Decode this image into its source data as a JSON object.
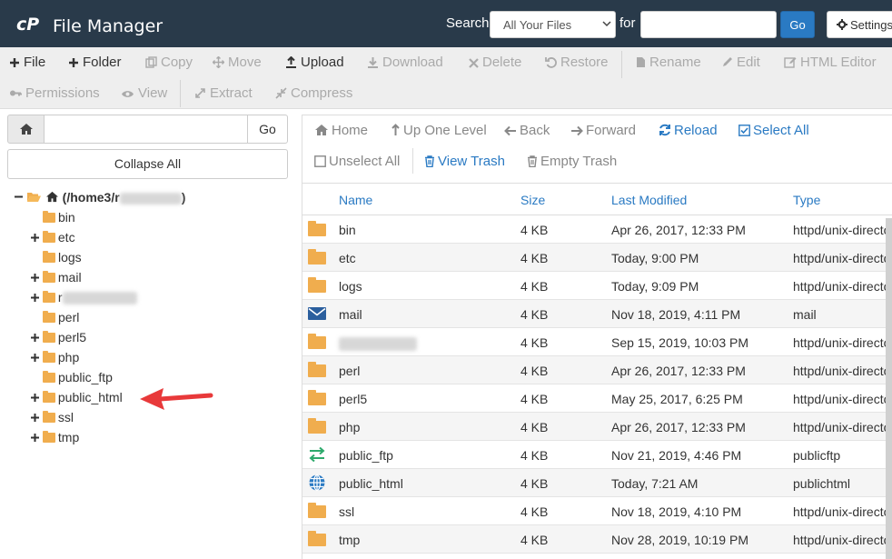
{
  "header": {
    "title": "File Manager",
    "logo_icon": "cpanel-logo",
    "search_label": "Search",
    "search_scope": "All Your Files",
    "for_label": "for",
    "search_value": "",
    "go_label": "Go",
    "settings_label": "Settings"
  },
  "toolbar": {
    "row1": [
      {
        "label": "File",
        "icon": "plus-icon",
        "enabled": true
      },
      {
        "label": "Folder",
        "icon": "plus-icon",
        "enabled": true
      },
      {
        "label": "Copy",
        "icon": "copy-icon",
        "enabled": false
      },
      {
        "label": "Move",
        "icon": "move-icon",
        "enabled": false
      },
      {
        "label": "Upload",
        "icon": "upload-icon",
        "enabled": true
      },
      {
        "label": "Download",
        "icon": "download-icon",
        "enabled": false
      },
      {
        "label": "Delete",
        "icon": "delete-icon",
        "enabled": false
      },
      {
        "label": "Restore",
        "icon": "restore-icon",
        "enabled": false
      },
      {
        "label": "Rename",
        "icon": "file-icon",
        "enabled": false
      },
      {
        "label": "Edit",
        "icon": "pencil-icon",
        "enabled": false
      },
      {
        "label": "HTML Editor",
        "icon": "edit-square-icon",
        "enabled": false
      }
    ],
    "row2": [
      {
        "label": "Permissions",
        "icon": "key-icon",
        "enabled": false
      },
      {
        "label": "View",
        "icon": "eye-icon",
        "enabled": false
      },
      {
        "label": "Extract",
        "icon": "expand-icon",
        "enabled": false
      },
      {
        "label": "Compress",
        "icon": "compress-icon",
        "enabled": false
      }
    ]
  },
  "left": {
    "path_value": "",
    "go_label": "Go",
    "collapse_label": "Collapse All",
    "root_label": "(/home3/r",
    "root_suffix": ")",
    "tree": [
      {
        "label": "bin",
        "expandable": false
      },
      {
        "label": "etc",
        "expandable": true
      },
      {
        "label": "logs",
        "expandable": false
      },
      {
        "label": "mail",
        "expandable": true
      },
      {
        "label": "r",
        "expandable": true,
        "blurred": true
      },
      {
        "label": "perl",
        "expandable": false
      },
      {
        "label": "perl5",
        "expandable": true
      },
      {
        "label": "php",
        "expandable": true
      },
      {
        "label": "public_ftp",
        "expandable": false
      },
      {
        "label": "public_html",
        "expandable": true
      },
      {
        "label": "ssl",
        "expandable": true
      },
      {
        "label": "tmp",
        "expandable": true
      }
    ]
  },
  "nav": {
    "home": "Home",
    "up": "Up One Level",
    "back": "Back",
    "forward": "Forward",
    "reload": "Reload",
    "select_all": "Select All",
    "unselect_all": "Unselect All",
    "view_trash": "View Trash",
    "empty_trash": "Empty Trash"
  },
  "table": {
    "columns": [
      "Name",
      "Size",
      "Last Modified",
      "Type"
    ],
    "rows": [
      {
        "icon": "folder-icon",
        "name": "bin",
        "size": "4 KB",
        "modified": "Apr 26, 2017, 12:33 PM",
        "type": "httpd/unix-directo"
      },
      {
        "icon": "folder-icon",
        "name": "etc",
        "size": "4 KB",
        "modified": "Today, 9:00 PM",
        "type": "httpd/unix-directo"
      },
      {
        "icon": "folder-icon",
        "name": "logs",
        "size": "4 KB",
        "modified": "Today, 9:09 PM",
        "type": "httpd/unix-directo"
      },
      {
        "icon": "mail-icon",
        "name": "mail",
        "size": "4 KB",
        "modified": "Nov 18, 2019, 4:11 PM",
        "type": "mail"
      },
      {
        "icon": "folder-icon",
        "name": "",
        "blurred": true,
        "size": "4 KB",
        "modified": "Sep 15, 2019, 10:03 PM",
        "type": "httpd/unix-directo"
      },
      {
        "icon": "folder-icon",
        "name": "perl",
        "size": "4 KB",
        "modified": "Apr 26, 2017, 12:33 PM",
        "type": "httpd/unix-directo"
      },
      {
        "icon": "folder-icon",
        "name": "perl5",
        "size": "4 KB",
        "modified": "May 25, 2017, 6:25 PM",
        "type": "httpd/unix-directo"
      },
      {
        "icon": "folder-icon",
        "name": "php",
        "size": "4 KB",
        "modified": "Apr 26, 2017, 12:33 PM",
        "type": "httpd/unix-directo"
      },
      {
        "icon": "exchange-icon",
        "name": "public_ftp",
        "size": "4 KB",
        "modified": "Nov 21, 2019, 4:46 PM",
        "type": "publicftp"
      },
      {
        "icon": "globe-icon",
        "name": "public_html",
        "size": "4 KB",
        "modified": "Today, 7:21 AM",
        "type": "publichtml"
      },
      {
        "icon": "folder-icon",
        "name": "ssl",
        "size": "4 KB",
        "modified": "Nov 18, 2019, 4:10 PM",
        "type": "httpd/unix-directo"
      },
      {
        "icon": "folder-icon",
        "name": "tmp",
        "size": "4 KB",
        "modified": "Nov 28, 2019, 10:19 PM",
        "type": "httpd/unix-directo"
      }
    ]
  },
  "colors": {
    "header_bg": "#293a4a",
    "accent_blue": "#2a7ac3",
    "folder": "#f0ad4e",
    "annotation_arrow": "#e8393a"
  }
}
